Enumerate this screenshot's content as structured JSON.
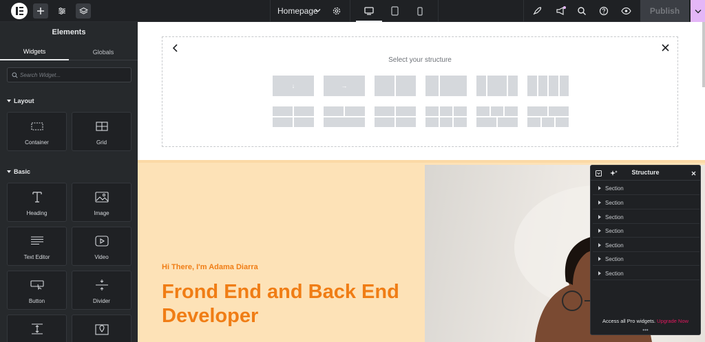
{
  "topbar": {
    "page_name": "Homepage",
    "publish_label": "Publish",
    "icons": [
      "elementor-logo",
      "add-icon",
      "settings-sliders-icon",
      "layers-icon",
      "chevron-down-icon",
      "gear-icon",
      "desktop-icon",
      "tablet-icon",
      "mobile-icon",
      "rocket-icon",
      "megaphone-icon",
      "search-icon",
      "help-icon",
      "eye-icon"
    ]
  },
  "sidebar": {
    "title": "Elements",
    "tabs": [
      "Widgets",
      "Globals"
    ],
    "search_placeholder": "Search Widget...",
    "categories": [
      {
        "label": "Layout",
        "widgets": [
          {
            "label": "Container",
            "icon": "container-icon"
          },
          {
            "label": "Grid",
            "icon": "grid-icon"
          }
        ]
      },
      {
        "label": "Basic",
        "widgets": [
          {
            "label": "Heading",
            "icon": "heading-icon"
          },
          {
            "label": "Image",
            "icon": "image-icon"
          },
          {
            "label": "Text Editor",
            "icon": "text-editor-icon"
          },
          {
            "label": "Video",
            "icon": "video-icon"
          },
          {
            "label": "Button",
            "icon": "button-icon"
          },
          {
            "label": "Divider",
            "icon": "divider-icon"
          },
          {
            "label": "",
            "icon": "spacer-icon"
          },
          {
            "label": "",
            "icon": "map-icon"
          }
        ]
      }
    ]
  },
  "picker": {
    "title": "Select your structure"
  },
  "hero": {
    "subtitle": "Hi There, I'm Adama Diarra",
    "title": "Frond End and Back End Developer"
  },
  "structure_panel": {
    "title": "Structure",
    "items": [
      "Section",
      "Section",
      "Section",
      "Section",
      "Section",
      "Section",
      "Section"
    ],
    "footer_text": "Access all Pro widgets.",
    "footer_link": "Upgrade Now"
  },
  "colors": {
    "accent_orange": "#f07d15",
    "hero_bg": "#fde2b7",
    "upgrade_pink": "#e3185f",
    "publish_caret": "#e4b6f7"
  }
}
